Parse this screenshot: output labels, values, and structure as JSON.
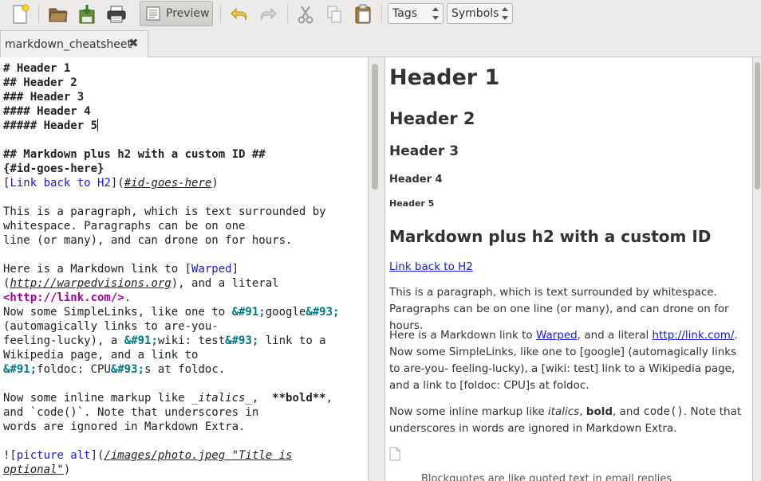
{
  "toolbar": {
    "icons": [
      "new-file-icon",
      "open-folder-icon",
      "save-icon",
      "print-icon",
      "preview-icon",
      "undo-icon",
      "redo-icon",
      "cut-icon",
      "copy-icon",
      "paste-icon"
    ],
    "preview_label": "Preview",
    "tags_label": "Tags",
    "symbols_label": "Symbols"
  },
  "tab": {
    "title": "markdown_cheatsheet",
    "close_symbol": "✖"
  },
  "editor": {
    "lines": {
      "l1": "# Header 1",
      "l2": "## Header 2",
      "l3": "### Header 3",
      "l4": "#### Header 4",
      "l5": "##### Header 5",
      "l7": "## Markdown plus h2 with a custom ID ##",
      "l8": "{#id-goes-here}",
      "l9a": "[",
      "l9b": "Link back to H2",
      "l9c": "](",
      "l9d": "#id-goes-here",
      "l9e": ")",
      "l11": "This is a paragraph, which is text surrounded by",
      "l12": "whitespace. Paragraphs can be on one",
      "l13": "line (or many), and can drone on for hours.",
      "l15a": "Here is a Markdown link to [",
      "l15b": "Warped",
      "l15c": "]",
      "l16a": "(",
      "l16b": "http://warpedvisions.org",
      "l16c": "), and a literal",
      "l17": "<http://link.com/>",
      "l17b": ".",
      "l18a": "Now some SimpleLinks, like one to ",
      "l18b": "&#91;",
      "l18c": "google",
      "l18d": "&#93;",
      "l19": "(automagically links to are-you-",
      "l20a": "feeling-lucky), a ",
      "l20b": "&#91;",
      "l20c": "wiki: test",
      "l20d": "&#93;",
      "l20e": " link to a",
      "l21": "Wikipedia page, and a link to",
      "l22a": "&#91;",
      "l22b": "foldoc: CPU",
      "l22c": "&#93;",
      "l22d": "s at foldoc.",
      "l24a": "Now some inline markup like ",
      "l24b": "_italics_",
      "l24c": ",  ",
      "l24d": "**bold**",
      "l24e": ",",
      "l25": "and `code()`. Note that underscores in",
      "l26": "words are ignored in Markdown Extra.",
      "l28a": "![",
      "l28b": "picture alt",
      "l28c": "](",
      "l28d": "/images/photo.jpeg \"Title is",
      "l29a": "optional\"",
      "l29b": ")"
    }
  },
  "preview": {
    "h1": "Header 1",
    "h2": "Header 2",
    "h3": "Header 3",
    "h4": "Header 4",
    "h5": "Header 5",
    "h_custom": "Markdown plus h2 with a custom ID",
    "link_back": "Link back to H2",
    "p1": "This is a paragraph, which is text surrounded by whitespace. Paragraphs can be on one line (or many), and can drone on for hours.",
    "p2_a": "Here is a Markdown link to ",
    "p2_link1": "Warped",
    "p2_b": ", and a literal ",
    "p2_link2": "http://link.com/",
    "p2_c": ". Now some SimpleLinks, like one to [google] (automagically links to are-you- feeling-lucky), a [wiki: test] link to a Wikipedia page, and a link to [foldoc: CPU]s at foldoc.",
    "p3_a": "Now some inline markup like ",
    "p3_italic": "italics",
    "p3_b": ", ",
    "p3_bold": "bold",
    "p3_c": ", and ",
    "p3_code": "code()",
    "p3_d": ". Note that underscores in words are ignored in Markdown Extra.",
    "quote_partial": "Blockquotes are like quoted text in email replies"
  },
  "colors": {
    "link": "#1a1acc",
    "entity": "#007a80",
    "autolink": "#a2009b",
    "background": "#ecebe9"
  }
}
